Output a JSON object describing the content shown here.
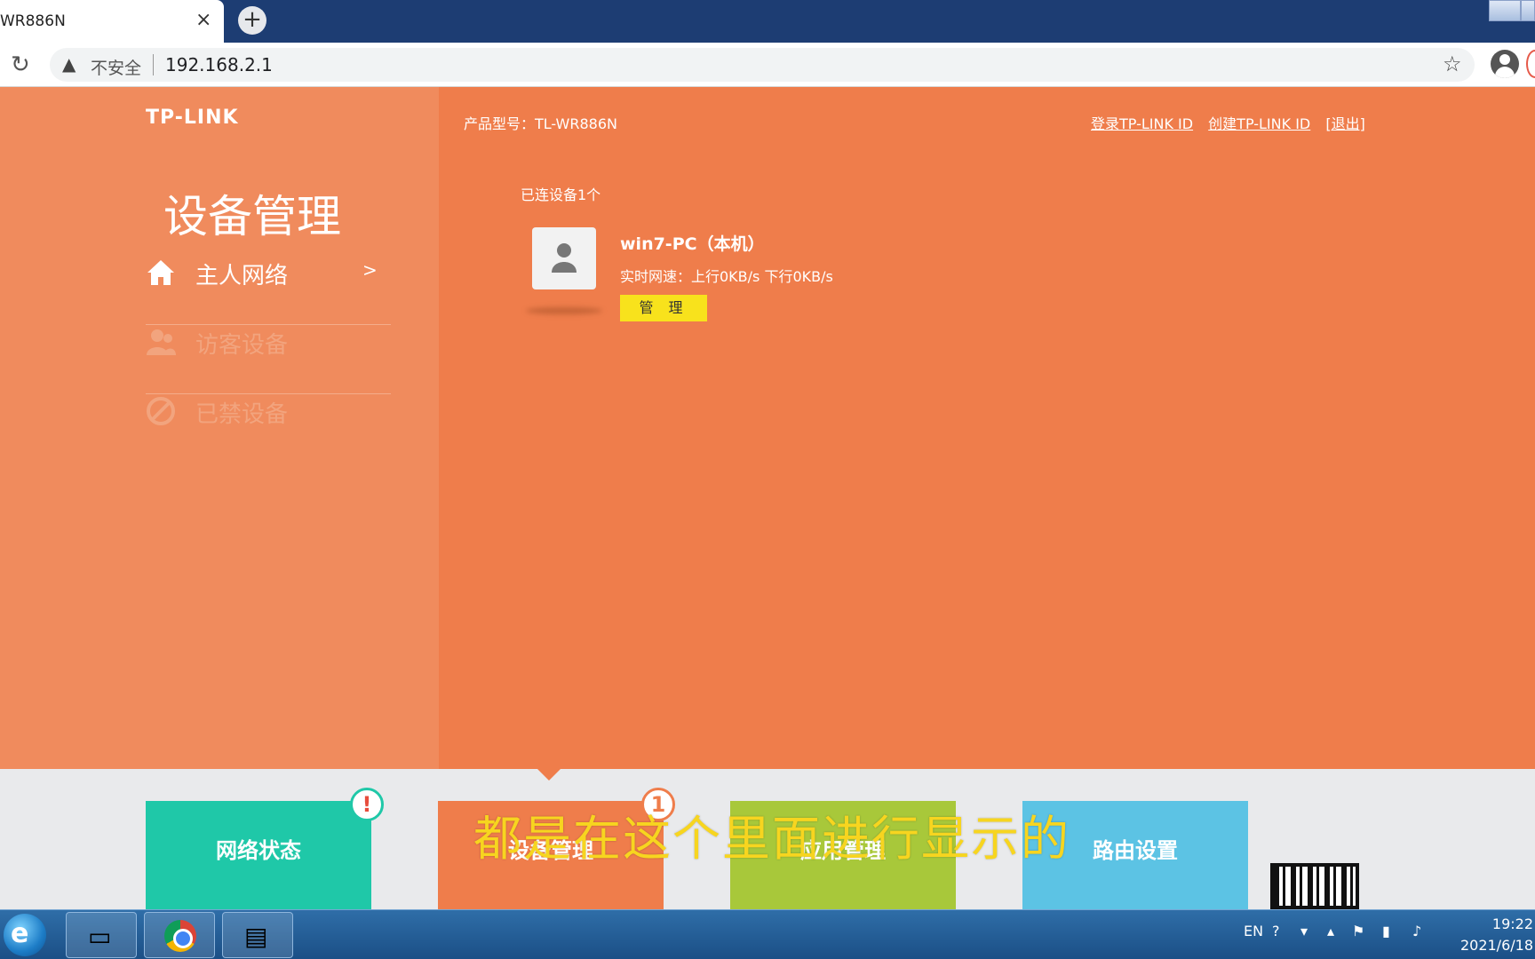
{
  "browser": {
    "tab_title": "WR886N",
    "tab_close": "×",
    "new_tab": "+",
    "security_label": "不安全",
    "url": "192.168.2.1"
  },
  "header": {
    "logo": "TP-LINK",
    "model": "产品型号：TL-WR886N",
    "links": [
      "登录TP-LINK ID",
      "创建TP-LINK ID",
      "[退出]"
    ]
  },
  "sidebar": {
    "title": "设备管理",
    "items": [
      {
        "label": "主人网络",
        "icon": "home-icon",
        "active": true
      },
      {
        "label": "访客设备",
        "icon": "guests-icon",
        "active": false
      },
      {
        "label": "已禁设备",
        "icon": "forbidden-icon",
        "active": false
      }
    ],
    "chevron": ">"
  },
  "main": {
    "connected_count": "已连设备1个",
    "device": {
      "name": "win7-PC（本机）",
      "speed": "实时网速：上行0KB/s  下行0KB/s",
      "manage_label": "管 理"
    }
  },
  "bottom_nav": {
    "tiles": [
      {
        "label": "网络状态",
        "color": "#1fc8a8",
        "badge": "!"
      },
      {
        "label": "设备管理",
        "color": "#ef7d4b",
        "badge": "1"
      },
      {
        "label": "应用管理",
        "color": "#a8c83a"
      },
      {
        "label": "路由设置",
        "color": "#5cc3e4"
      }
    ]
  },
  "subtitle": "都是在这个里面进行显示的",
  "taskbar": {
    "language": "EN",
    "time": "19:22",
    "date": "2021/6/18"
  },
  "colors": {
    "primary_orange": "#ef7d4b",
    "sidebar_orange": "#f08b5d",
    "manage_yellow": "#f8e21c",
    "subtitle_yellow": "#f7d51f"
  }
}
